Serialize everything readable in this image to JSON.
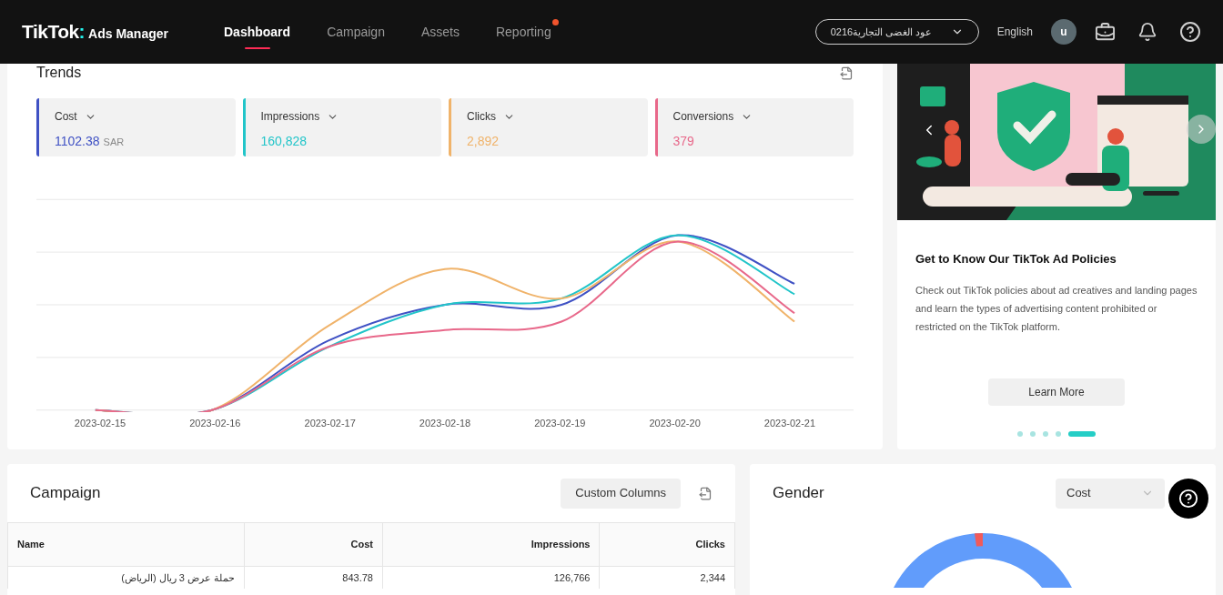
{
  "header": {
    "brand": "TikTok",
    "brand_separator": ":",
    "product": "Ads Manager",
    "nav": [
      {
        "label": "Dashboard",
        "selected": true,
        "notification": false
      },
      {
        "label": "Campaign",
        "selected": false,
        "notification": false
      },
      {
        "label": "Assets",
        "selected": false,
        "notification": false
      },
      {
        "label": "Reporting",
        "selected": false,
        "notification": true
      }
    ],
    "account_selector": {
      "value": "عود الغضى التجارية0216"
    },
    "language": "English",
    "avatar_letter": "u"
  },
  "trends": {
    "title": "Trends",
    "metrics": [
      {
        "label": "Cost",
        "value": "1102.38",
        "unit": "SAR",
        "color": "#3f51c4"
      },
      {
        "label": "Impressions",
        "value": "160,828",
        "color": "#22c5c9"
      },
      {
        "label": "Clicks",
        "value": "2,892",
        "color": "#f0b36a"
      },
      {
        "label": "Conversions",
        "value": "379",
        "color": "#e8688a"
      }
    ],
    "x_labels": [
      "2023-02-15",
      "2023-02-16",
      "2023-02-17",
      "2023-02-18",
      "2023-02-19",
      "2023-02-20",
      "2023-02-21"
    ]
  },
  "promo": {
    "title": "Get to Know Our TikTok Ad Policies",
    "body": "Check out TikTok policies about ad creatives and landing pages and learn the types of advertising content prohibited or restricted on the TikTok platform.",
    "button": "Learn More",
    "slides": [
      {
        "selected": false
      },
      {
        "selected": false
      },
      {
        "selected": false
      },
      {
        "selected": false
      },
      {
        "selected": true
      }
    ]
  },
  "campaign": {
    "title": "Campaign",
    "custom_columns_button": "Custom Columns",
    "columns": [
      "Name",
      "Cost",
      "Impressions",
      "Clicks"
    ],
    "rows": [
      [
        "حملة عرض 3 ريال (الرياض)",
        "843.78",
        "126,766",
        "2,344"
      ]
    ]
  },
  "gender": {
    "title": "Gender",
    "metric_select": "Cost"
  }
}
